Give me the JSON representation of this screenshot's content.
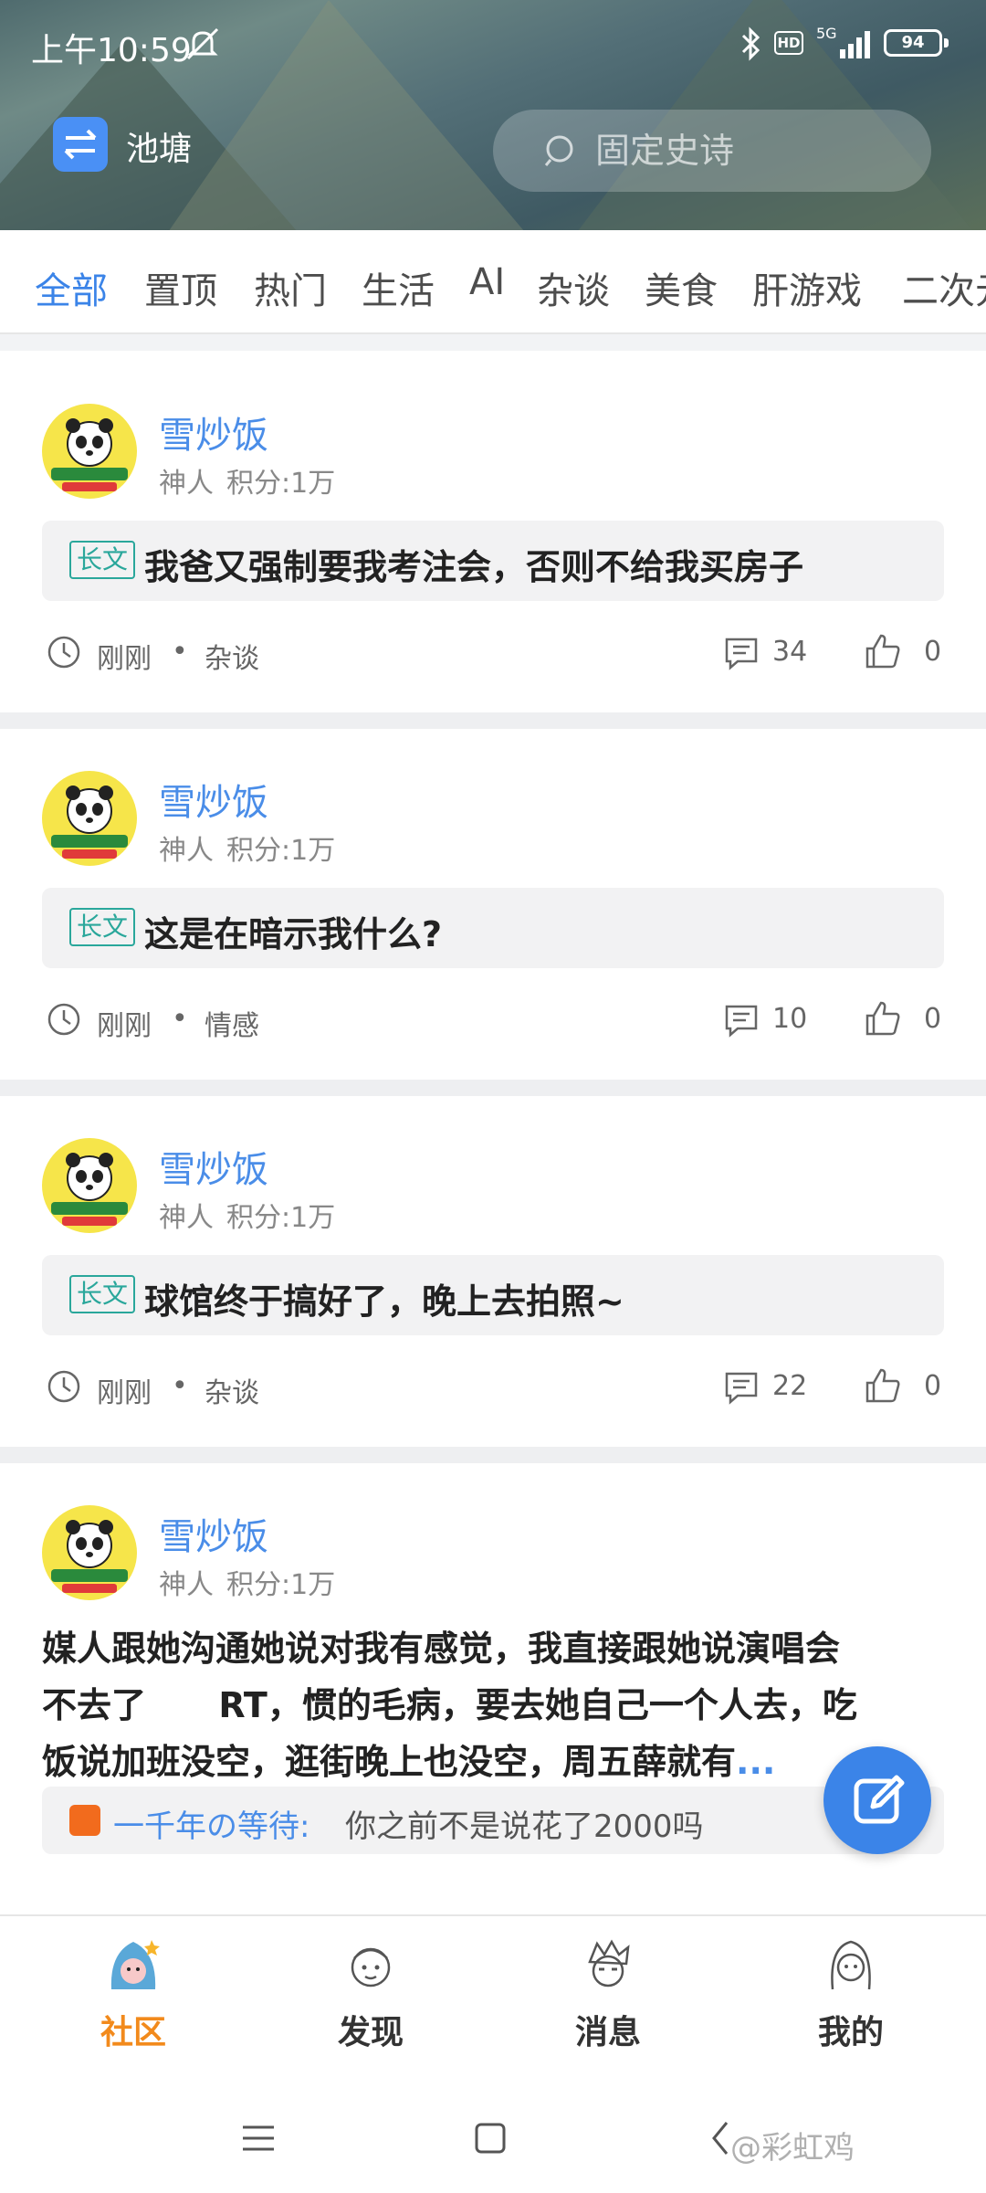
{
  "status_bar": {
    "time": "上午10:59",
    "hd": "HD",
    "network": "5G",
    "battery": "94"
  },
  "header": {
    "board_name": "池塘",
    "search_placeholder": "固定史诗"
  },
  "tabs": [
    {
      "label": "全部",
      "active": true
    },
    {
      "label": "置顶",
      "active": false
    },
    {
      "label": "热门",
      "active": false
    },
    {
      "label": "生活",
      "active": false
    },
    {
      "label": "AI",
      "active": false
    },
    {
      "label": "杂谈",
      "active": false
    },
    {
      "label": "美食",
      "active": false
    },
    {
      "label": "肝游戏",
      "active": false
    },
    {
      "label": "二次元",
      "active": false
    }
  ],
  "posts": [
    {
      "author": "雪炒饭",
      "rank": "神人",
      "score": "积分:1万",
      "tag": "长文",
      "title": "我爸又强制要我考注会，否则不给我买房子",
      "time": "刚刚",
      "dot": "•",
      "category": "杂谈",
      "comments": "34",
      "likes": "0"
    },
    {
      "author": "雪炒饭",
      "rank": "神人",
      "score": "积分:1万",
      "tag": "长文",
      "title": "这是在暗示我什么?",
      "time": "刚刚",
      "dot": "•",
      "category": "情感",
      "comments": "10",
      "likes": "0"
    },
    {
      "author": "雪炒饭",
      "rank": "神人",
      "score": "积分:1万",
      "tag": "长文",
      "title": "球馆终于搞好了，晚上去拍照~",
      "time": "刚刚",
      "dot": "•",
      "category": "杂谈",
      "comments": "22",
      "likes": "0"
    },
    {
      "author": "雪炒饭",
      "rank": "神人",
      "score": "积分:1万",
      "body_line1": "媒人跟她沟通她说对我有感觉，我直接跟她说演唱会",
      "body_line2": "不去了      RT，惯的毛病，要去她自己一个人去，吃",
      "body_line3": "饭说加班没空，逛街晚上也没空，周五薛就有",
      "more": "...",
      "reply_user": "一千年の等待:",
      "reply_text": "你之前不是说花了2000吗"
    }
  ],
  "bottom_nav": [
    {
      "label": "社区",
      "active": true
    },
    {
      "label": "发现",
      "active": false
    },
    {
      "label": "消息",
      "active": false
    },
    {
      "label": "我的",
      "active": false
    }
  ],
  "watermark": "@彩虹鸡",
  "colors": {
    "accent": "#3b84e8",
    "active_nav": "#f28a1c",
    "tag": "#2aa79b"
  }
}
